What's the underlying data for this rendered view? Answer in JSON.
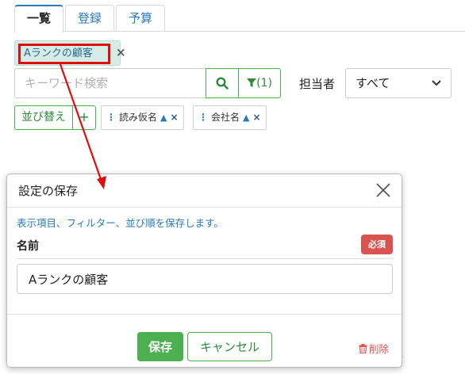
{
  "tabs": [
    {
      "label": "一覧",
      "active": true
    },
    {
      "label": "登録",
      "active": false
    },
    {
      "label": "予算",
      "active": false
    }
  ],
  "filter_chip": {
    "label": "Aランクの顧客",
    "close": "×"
  },
  "search": {
    "placeholder": "キーワード検索",
    "filter_count": "(1)"
  },
  "owner": {
    "label": "担当者",
    "selected": "すべて"
  },
  "sort": {
    "button_label": "並び替え",
    "add_label": "+",
    "tags": [
      {
        "label": "読み仮名",
        "direction": "▲"
      },
      {
        "label": "会社名",
        "direction": "▲"
      }
    ],
    "remove": "×"
  },
  "modal": {
    "title": "設定の保存",
    "description": "表示項目、フィルター、並び順を保存します。",
    "field_label": "名前",
    "required_badge": "必須",
    "name_value": "Aランクの顧客",
    "save_label": "保存",
    "cancel_label": "キャンセル",
    "delete_label": "削除"
  },
  "colors": {
    "accent_green": "#4caf50",
    "link_blue": "#2a7ab8",
    "danger_red": "#d9534f",
    "annotation_red": "#e00d0d"
  },
  "icons": [
    "search-icon",
    "funnel-icon",
    "chevron-down-icon",
    "close-icon",
    "trash-icon",
    "drag-handle-icon"
  ]
}
